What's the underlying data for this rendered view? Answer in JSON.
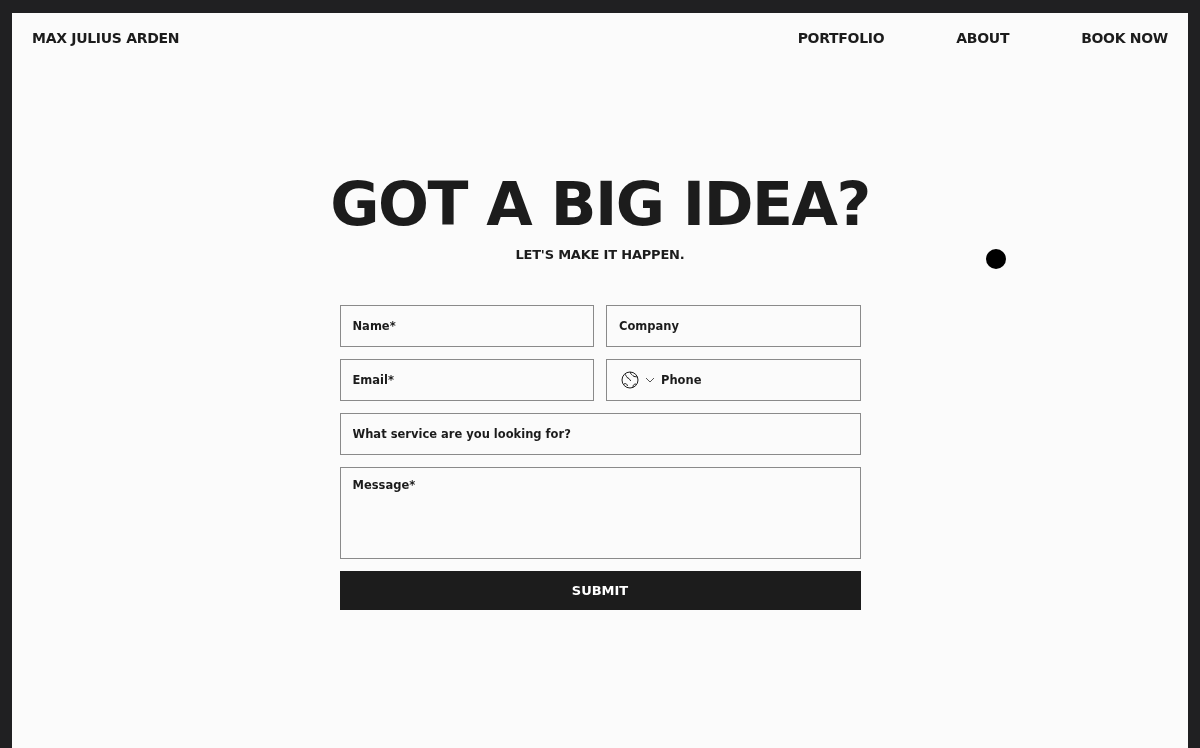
{
  "brand": "MAX JULIUS ARDEN",
  "nav": [
    {
      "label": "PORTFOLIO"
    },
    {
      "label": "ABOUT"
    },
    {
      "label": "BOOK NOW"
    }
  ],
  "heading": "GOT A BIG IDEA?",
  "subheading": "LET'S MAKE IT HAPPEN.",
  "form": {
    "fields": [
      {
        "kind": "text",
        "placeholder": "Name*"
      },
      {
        "kind": "text",
        "placeholder": "Company"
      },
      {
        "kind": "text",
        "placeholder": "Email*"
      },
      {
        "kind": "phone",
        "placeholder": "Phone"
      },
      {
        "kind": "wide",
        "placeholder": "What service are you looking for?"
      },
      {
        "kind": "textarea",
        "placeholder": "Message*"
      }
    ],
    "submit": "SUBMIT"
  }
}
